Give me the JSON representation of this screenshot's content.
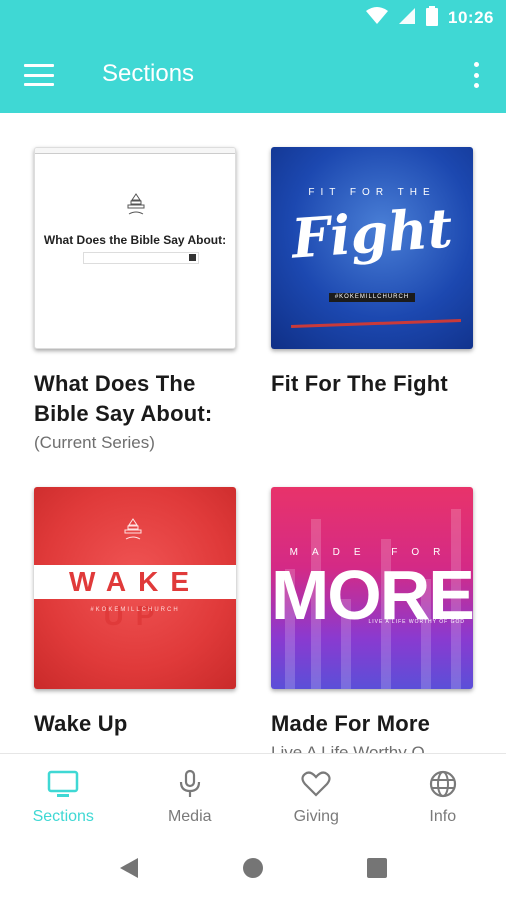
{
  "status_bar": {
    "time": "10:26",
    "icons": [
      "wifi-icon",
      "signal-icon",
      "battery-icon"
    ]
  },
  "app_bar": {
    "title": "Sections",
    "menu_icon": "hamburger-menu-icon",
    "overflow_icon": "more-vert-icon"
  },
  "thumbnails": {
    "card1_heading": "What Does the Bible Say About:",
    "card2_top": "FIT FOR THE",
    "card2_main": "Fight",
    "card2_tag": "#KOKEMILLCHURCH",
    "card3_main": "WAKE UP",
    "card3_sub": "#KOKEMILLCHURCH",
    "card4_top": "MADE FOR",
    "card4_main": "MORE",
    "card4_caption": "LIVE A LIFE WORTHY OF GOD"
  },
  "cards": [
    {
      "title": "What Does The Bible Say About:",
      "subtitle": "(Current Series)"
    },
    {
      "title": "Fit For The Fight",
      "subtitle": ""
    },
    {
      "title": "Wake Up",
      "subtitle": ""
    },
    {
      "title": "Made For More",
      "subtitle": "Live A Life Worthy O"
    }
  ],
  "bottom_nav": [
    {
      "label": "Sections",
      "icon": "tv-icon",
      "active": true
    },
    {
      "label": "Media",
      "icon": "microphone-icon",
      "active": false
    },
    {
      "label": "Giving",
      "icon": "heart-icon",
      "active": false
    },
    {
      "label": "Info",
      "icon": "globe-icon",
      "active": false
    }
  ],
  "colors": {
    "accent": "#3fd8d4",
    "text": "#1a1a1a",
    "muted": "#7a7a7a"
  },
  "system_nav": [
    "back-icon",
    "home-icon",
    "recents-icon"
  ]
}
